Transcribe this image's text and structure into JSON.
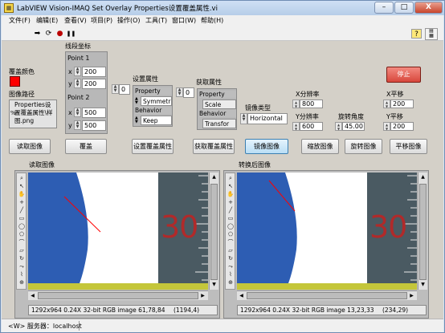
{
  "window": {
    "title": "LabVIEW Vision-IMAQ Set Overlay Properties设置覆盖属性.vi"
  },
  "window_controls": {
    "minimize": "–",
    "maximize": "□",
    "close": "X"
  },
  "menu": [
    "文件(F)",
    "编辑(E)",
    "查看(V)",
    "项目(P)",
    "操作(O)",
    "工具(T)",
    "窗口(W)",
    "帮助(H)"
  ],
  "toolbar": {
    "run": "➡",
    "run_cont": "⟳",
    "abort": "●",
    "pause": "❚❚",
    "help": "?"
  },
  "colors": {
    "overlay_color": "#ff0000",
    "stop_bg": "#e8645a",
    "image_blue": "#2d5db3",
    "image_dark": "#4a5a62",
    "image_digit": "#b02a2a"
  },
  "left": {
    "overlay_color_label": "覆盖颜色",
    "image_path_label": "图像路径",
    "image_path_value": "Properties设置覆盖属性\\样图.png",
    "image_path_prefix": "%"
  },
  "segment": {
    "label": "线段坐标",
    "point1": {
      "label": "Point 1",
      "x_label": "x",
      "y_label": "y",
      "x": "200",
      "y": "200"
    },
    "point2": {
      "label": "Point 2",
      "x_label": "x",
      "y_label": "y",
      "x": "500",
      "y": "500"
    }
  },
  "set_props": {
    "label": "设置属性",
    "index": "0",
    "items": [
      "Property",
      "Symmetr",
      "Behavior",
      "Keep"
    ]
  },
  "get_props": {
    "label": "获取属性",
    "index": "0",
    "items": [
      "Property",
      "Scale",
      "Behavior",
      "Transfor"
    ]
  },
  "mirror": {
    "label": "镜像类型",
    "value": "Horizontal"
  },
  "x_res": {
    "label": "X分辨率",
    "value": "800"
  },
  "y_res": {
    "label": "Y分辨率",
    "value": "600"
  },
  "rotation": {
    "label": "旋转角度",
    "value": "45.00"
  },
  "x_shift": {
    "label": "X平移",
    "value": "200"
  },
  "y_shift": {
    "label": "Y平移",
    "value": "200"
  },
  "stop_button": "停止",
  "buttons": [
    "读取图像",
    "覆盖",
    "设置覆盖属性",
    "获取覆盖属性",
    "镜像图像",
    "缩放图像",
    "旋转图像",
    "平移图像"
  ],
  "display_left": {
    "label": "读取图像",
    "status": "1292x964 0.24X 32-bit RGB image 61,78,84",
    "coord": "(1194,4)",
    "digit": "30"
  },
  "display_right": {
    "label": "转换后图像",
    "status": "1292x964 0.24X 32-bit RGB image 13,23,33",
    "coord": "(234,29)",
    "digit": "30"
  },
  "palette_tools": [
    "⌕",
    "↖",
    "✋",
    "+",
    "╱",
    "▭",
    "◯",
    "⬠",
    "⌒",
    "▱",
    "↻",
    "⤳",
    "⌇",
    "⊕"
  ],
  "status": {
    "text": "<W> 服务器：localhost"
  }
}
